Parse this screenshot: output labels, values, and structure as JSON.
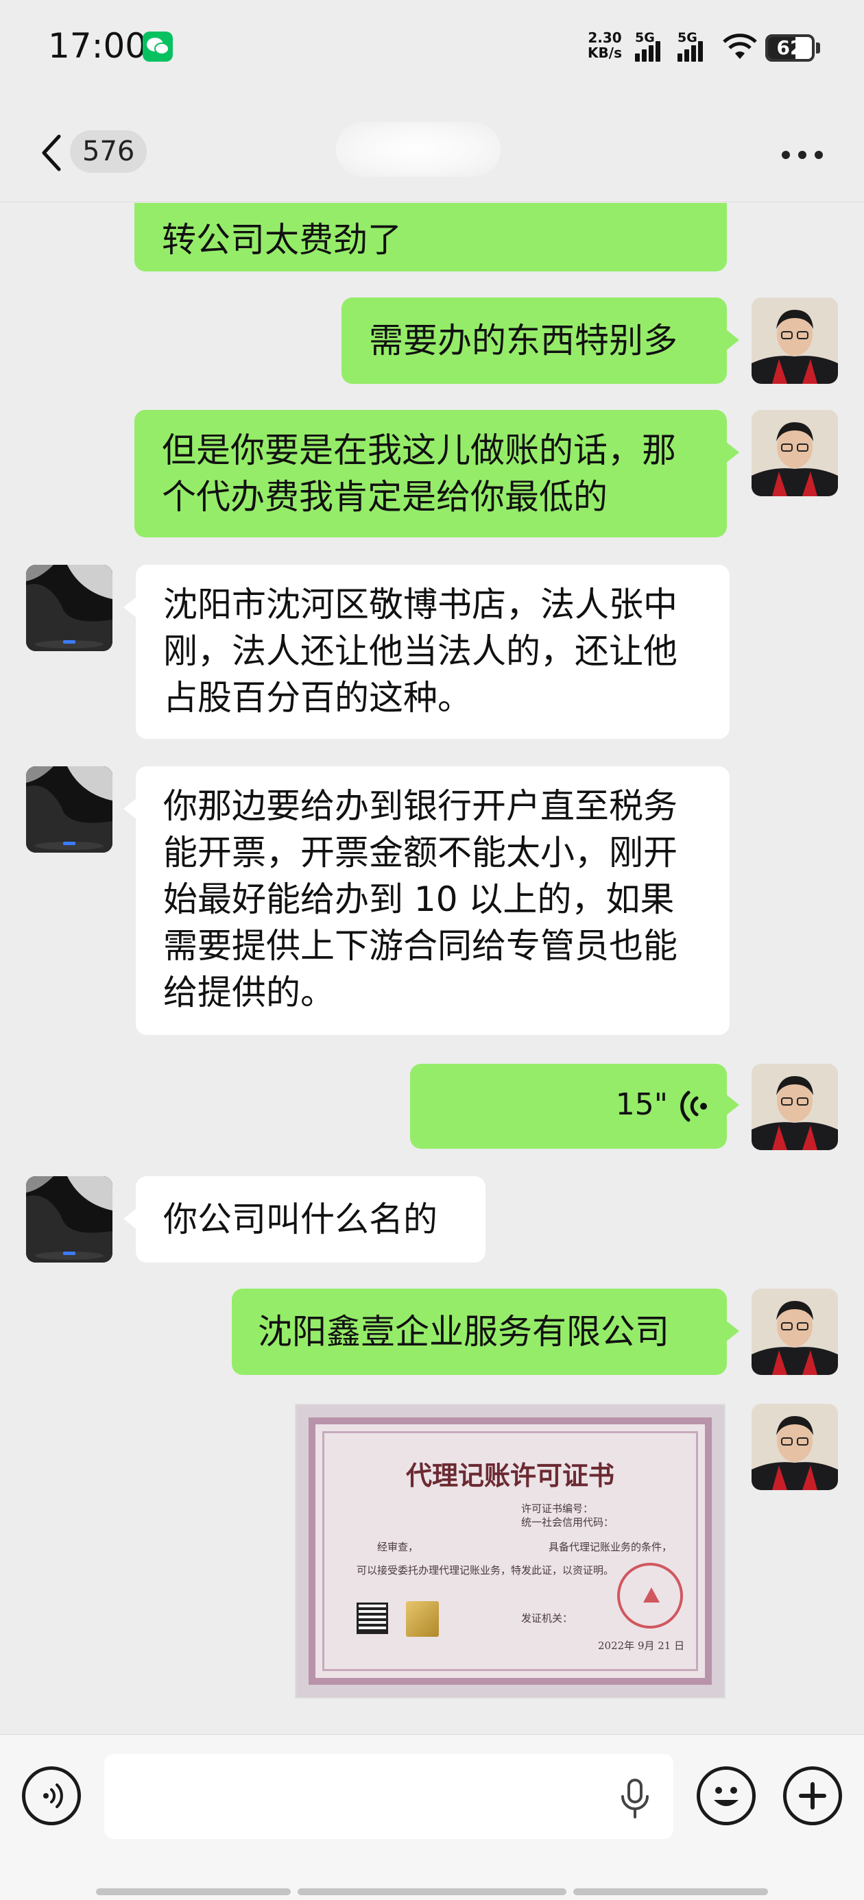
{
  "status_bar": {
    "time": "17:00",
    "network_speed": "2.30",
    "network_speed_unit": "KB/s",
    "sim1_label": "5G",
    "sim2_label": "5G",
    "battery_level": "62",
    "battery_fraction": 0.62,
    "icons": [
      "wechat-icon",
      "signal-icon",
      "wifi-icon",
      "battery-icon"
    ]
  },
  "header": {
    "unread_count": "576",
    "icons": [
      "back-icon",
      "more-icon"
    ]
  },
  "messages": [
    {
      "id": 1,
      "from": "me",
      "type": "text",
      "text": "转公司太费劲了"
    },
    {
      "id": 2,
      "from": "me",
      "type": "text",
      "text": "需要办的东西特别多"
    },
    {
      "id": 3,
      "from": "me",
      "type": "text",
      "lines": [
        "但是你要是在我这儿做账的话，那",
        "个代办费我肯定是给你最低的"
      ]
    },
    {
      "id": 4,
      "from": "other",
      "type": "text",
      "lines": [
        "沈阳市沈河区敬博书店，法人张中",
        "刚，法人还让他当法人的，还让他",
        "占股百分百的这种。"
      ]
    },
    {
      "id": 5,
      "from": "other",
      "type": "text",
      "lines": [
        "你那边要给办到银行开户直至税务",
        "能开票，开票金额不能太小，刚开",
        "始最好能给办到 10 以上的，如果",
        "需要提供上下游合同给专管员也能",
        "给提供的。"
      ]
    },
    {
      "id": 6,
      "from": "me",
      "type": "voice",
      "duration": "15\""
    },
    {
      "id": 7,
      "from": "other",
      "type": "text",
      "text": "你公司叫什么名的"
    },
    {
      "id": 8,
      "from": "me",
      "type": "text",
      "text": "沈阳鑫壹企业服务有限公司"
    },
    {
      "id": 9,
      "from": "me",
      "type": "image",
      "image": {
        "title": "代理记账许可证书",
        "line_cert_no": "许可证书编号：",
        "line_credit_code": "统一社会信用代码：",
        "line_review": "经审查，",
        "line_conditions": "具备代理记账业务的条件，",
        "line_permit": "可以接受委托办理代理记账业务，特发此证，以资证明。",
        "line_issuer": "发证机关：",
        "line_date": "2022年 9月 21 日"
      }
    }
  ],
  "input_bar": {
    "icons": [
      "voice-toggle-icon",
      "microphone-icon",
      "emoji-icon",
      "plus-icon"
    ]
  }
}
